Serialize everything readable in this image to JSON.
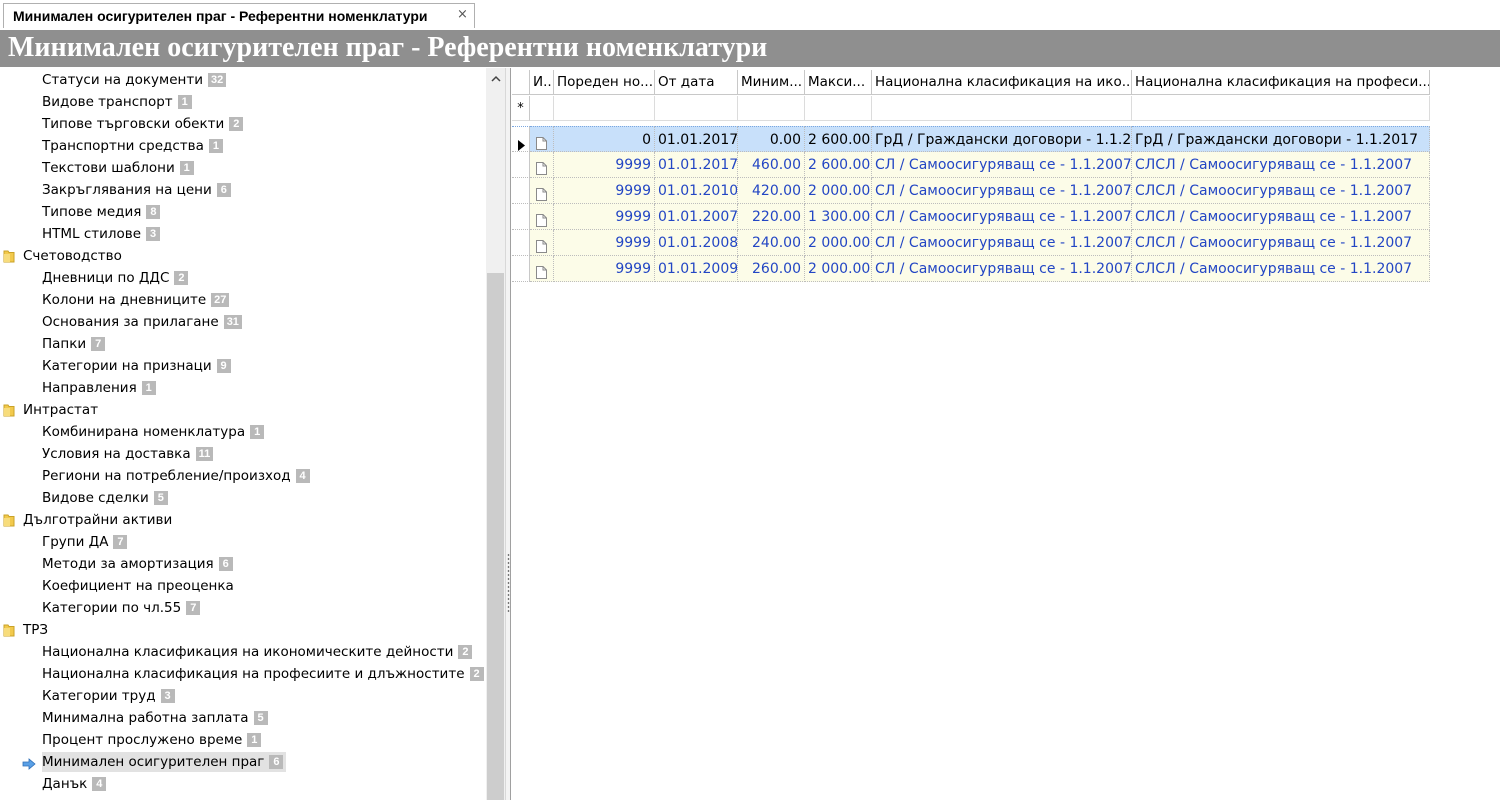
{
  "tab": {
    "label": "Минимален осигурителен праг - Референтни номенклатури",
    "close_glyph": "×"
  },
  "header": {
    "title": "Минимален осигурителен праг - Референтни номенклатури"
  },
  "tree": {
    "items": [
      {
        "label": "Статуси на документи",
        "count": "32",
        "level": 1
      },
      {
        "label": "Видове транспорт",
        "count": "1",
        "level": 1
      },
      {
        "label": "Типове търговски обекти",
        "count": "2",
        "level": 1
      },
      {
        "label": "Транспортни средства",
        "count": "1",
        "level": 1
      },
      {
        "label": "Текстови шаблони",
        "count": "1",
        "level": 1
      },
      {
        "label": "Закръглявания на цени",
        "count": "6",
        "level": 1
      },
      {
        "label": "Типове медия",
        "count": "8",
        "level": 1
      },
      {
        "label": "HTML стилове",
        "count": "3",
        "level": 1
      },
      {
        "label": "Счетоводство",
        "count": "",
        "level": 0
      },
      {
        "label": "Дневници по ДДС",
        "count": "2",
        "level": 1
      },
      {
        "label": "Колони на дневниците",
        "count": "27",
        "level": 1
      },
      {
        "label": "Основания за прилагане",
        "count": "31",
        "level": 1
      },
      {
        "label": "Папки",
        "count": "7",
        "level": 1
      },
      {
        "label": "Категории на признаци",
        "count": "9",
        "level": 1
      },
      {
        "label": "Направления",
        "count": "1",
        "level": 1
      },
      {
        "label": "Интрастат",
        "count": "",
        "level": 0
      },
      {
        "label": "Комбинирана номенклатура",
        "count": "1",
        "level": 1
      },
      {
        "label": "Условия на доставка",
        "count": "11",
        "level": 1
      },
      {
        "label": "Региони на потребление/произход",
        "count": "4",
        "level": 1
      },
      {
        "label": "Видове сделки",
        "count": "5",
        "level": 1
      },
      {
        "label": "Дълготрайни активи",
        "count": "",
        "level": 0
      },
      {
        "label": "Групи ДА",
        "count": "7",
        "level": 1
      },
      {
        "label": "Методи за амортизация",
        "count": "6",
        "level": 1
      },
      {
        "label": "Коефициент на преоценка",
        "count": "",
        "level": 1
      },
      {
        "label": "Категории по чл.55",
        "count": "7",
        "level": 1
      },
      {
        "label": "ТРЗ",
        "count": "",
        "level": 0
      },
      {
        "label": "Национална класификация на икономическите дейности",
        "count": "2",
        "level": 1
      },
      {
        "label": "Национална класификация на професиите и длъжностите",
        "count": "2",
        "level": 1
      },
      {
        "label": "Категории труд",
        "count": "3",
        "level": 1
      },
      {
        "label": "Минимална работна заплата",
        "count": "5",
        "level": 1
      },
      {
        "label": "Процент прослужено време",
        "count": "1",
        "level": 1
      },
      {
        "label": "Минимален осигурителен праг",
        "count": "6",
        "level": 1,
        "selected": true
      },
      {
        "label": "Данък",
        "count": "4",
        "level": 1
      }
    ]
  },
  "grid": {
    "columns": [
      {
        "label": "И..."
      },
      {
        "label": "Пореден но..."
      },
      {
        "label": "От дата"
      },
      {
        "label": "Миним..."
      },
      {
        "label": "Макси..."
      },
      {
        "label": "Национална класификация на ико..."
      },
      {
        "label": "Национална класификация на професи..."
      }
    ],
    "new_row_marker": "*",
    "rows": [
      {
        "seq": "0",
        "date": "01.01.2017",
        "min": "0.00",
        "max": "2 600.00",
        "nkid": "ГрД / Граждански договори - 1.1.2...",
        "nkpd": "ГрД / Граждански договори - 1.1.2017",
        "selected": true
      },
      {
        "seq": "9999",
        "date": "01.01.2017",
        "min": "460.00",
        "max": "2 600.00",
        "nkid": "СЛ / Самоосигуряващ се - 1.1.2007",
        "nkpd": "СЛСЛ / Самоосигуряващ се - 1.1.2007"
      },
      {
        "seq": "9999",
        "date": "01.01.2010",
        "min": "420.00",
        "max": "2 000.00",
        "nkid": "СЛ / Самоосигуряващ се - 1.1.2007",
        "nkpd": "СЛСЛ / Самоосигуряващ се - 1.1.2007"
      },
      {
        "seq": "9999",
        "date": "01.01.2007",
        "min": "220.00",
        "max": "1 300.00",
        "nkid": "СЛ / Самоосигуряващ се - 1.1.2007",
        "nkpd": "СЛСЛ / Самоосигуряващ се - 1.1.2007"
      },
      {
        "seq": "9999",
        "date": "01.01.2008",
        "min": "240.00",
        "max": "2 000.00",
        "nkid": "СЛ / Самоосигуряващ се - 1.1.2007",
        "nkpd": "СЛСЛ / Самоосигуряващ се - 1.1.2007"
      },
      {
        "seq": "9999",
        "date": "01.01.2009",
        "min": "260.00",
        "max": "2 000.00",
        "nkid": "СЛ / Самоосигуряващ се - 1.1.2007",
        "nkpd": "СЛСЛ / Самоосигуряващ се - 1.1.2007"
      }
    ]
  },
  "icons": {
    "folder": "folder-icon",
    "current": "arrow-right-icon",
    "document": "document-icon",
    "row_pointer": "row-pointer-icon",
    "scroll_up": "chevron-up-icon",
    "close": "close-icon"
  },
  "colors": {
    "header_band": "#8f8f8f",
    "selected_row": "#c8e0fa",
    "row_background": "#fcfce8",
    "link_text": "#2346c4",
    "badge": "#b9b9b9"
  }
}
